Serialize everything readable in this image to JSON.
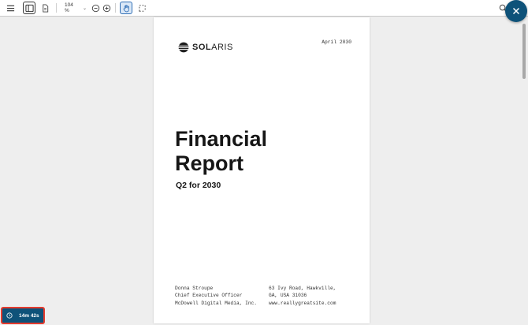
{
  "toolbar": {
    "zoom_value": "104 %",
    "zoom_dropdown_glyph": "⌄"
  },
  "document": {
    "logo": {
      "bold": "SOL",
      "light": "ARIS"
    },
    "date": "April 2030",
    "title_line1": "Financial",
    "title_line2": "Report",
    "subtitle": "Q2 for 2030",
    "contact_left": [
      "Donna Stroupe",
      "Chief Executive Officer",
      "McDowell Digital Media, Inc."
    ],
    "contact_right": [
      "63 Ivy Road, Hawkville,",
      "GA, USA 31036",
      "www.reallygreatsite.com"
    ]
  },
  "timer": {
    "label": "14m 42s"
  },
  "colors": {
    "accent": "#0e5279",
    "timer_border": "#e43b2e",
    "pan_active": "#2e6db4"
  },
  "icons": [
    "menu-icon",
    "sidebar-toggle-icon",
    "document-icon",
    "zoom-out-icon",
    "zoom-in-icon",
    "pan-hand-icon",
    "select-icon",
    "search-icon",
    "close-icon",
    "clock-icon",
    "globe-logo-icon"
  ]
}
